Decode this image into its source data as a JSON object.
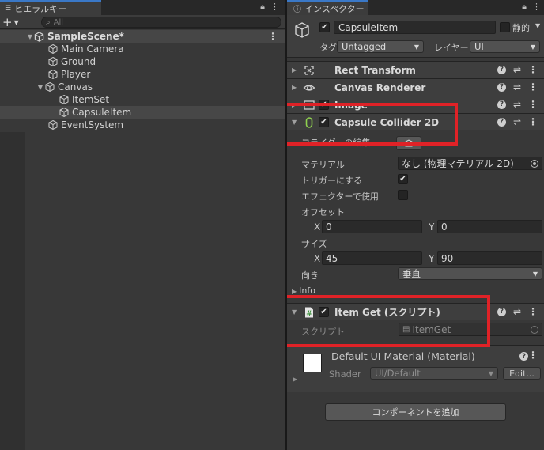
{
  "hierarchy": {
    "tab_label": "ヒエラルキー",
    "search_placeholder": "All",
    "scene_name": "SampleScene*",
    "items": [
      {
        "label": "Main Camera"
      },
      {
        "label": "Ground"
      },
      {
        "label": "Player"
      },
      {
        "label": "Canvas"
      },
      {
        "label": "ItemSet"
      },
      {
        "label": "CapsuleItem"
      },
      {
        "label": "EventSystem"
      }
    ]
  },
  "inspector": {
    "tab_label": "インスペクター",
    "object": {
      "name": "CapsuleItem",
      "static_label": "静的",
      "tag_label": "タグ",
      "tag_value": "Untagged",
      "layer_label": "レイヤー",
      "layer_value": "UI"
    },
    "components": {
      "rect_transform": "Rect Transform",
      "canvas_renderer": "Canvas Renderer",
      "image_partial": "Image",
      "capsule_collider": "Capsule Collider 2D",
      "item_get": "Item Get (スクリプト)"
    },
    "collider_props": {
      "edit_label": "コライダーの編集",
      "material_label": "マテリアル",
      "material_value": "なし (物理マテリアル 2D)",
      "trigger_label": "トリガーにする",
      "effector_label": "エフェクターで使用",
      "offset_label": "オフセット",
      "offset_x_label": "X",
      "offset_x": "0",
      "offset_y_label": "Y",
      "offset_y": "0",
      "size_label": "サイズ",
      "size_x_label": "X",
      "size_x": "45",
      "size_y_label": "Y",
      "size_y": "90",
      "direction_label": "向き",
      "direction_value": "垂直",
      "info_label": "Info"
    },
    "script_props": {
      "script_label": "スクリプト",
      "script_value": "ItemGet"
    },
    "material": {
      "title": "Default UI Material (Material)",
      "shader_label": "Shader",
      "shader_value": "UI/Default",
      "edit_label": "Edit..."
    },
    "add_component_label": "コンポーネントを追加"
  },
  "colors": {
    "highlight": "#e02227",
    "accent": "#3a78c7",
    "panel_bg": "#383838"
  }
}
